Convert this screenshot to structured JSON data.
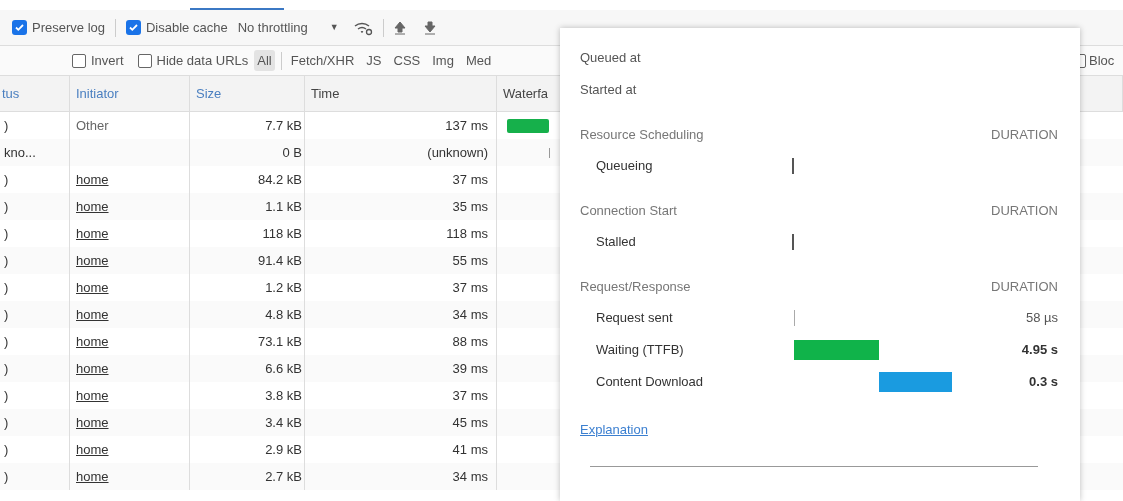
{
  "toolbar": {
    "checkboxes": [
      {
        "label": "Preserve log",
        "checked": true
      },
      {
        "label": "Disable cache",
        "checked": true
      }
    ],
    "throttling": {
      "value": "No throttling",
      "caret": "▼"
    }
  },
  "filter_bar": {
    "invert": {
      "label": "Invert",
      "checked": false
    },
    "hide_data_urls": {
      "label": "Hide data URLs",
      "checked": false
    },
    "types": [
      {
        "label": "All",
        "selected": true
      },
      {
        "label": "Fetch/XHR",
        "selected": false
      },
      {
        "label": "JS",
        "selected": false
      },
      {
        "label": "CSS",
        "selected": false
      },
      {
        "label": "Img",
        "selected": false
      },
      {
        "label": "Med",
        "selected": false
      }
    ],
    "blocked": {
      "label": "Bloc",
      "checked": false
    }
  },
  "table": {
    "columns": [
      "tus",
      "Initiator",
      "Size",
      "Time",
      "Waterfa"
    ],
    "rows": [
      {
        "status": ")",
        "initiator": "Other",
        "initiator_link": false,
        "size": "7.7 kB",
        "time": "137 ms",
        "kind": "bar"
      },
      {
        "status": "kno...",
        "size": "0 B",
        "time": "(unknown)",
        "kind": "tick"
      },
      {
        "status": ")",
        "initiator": "home",
        "initiator_link": true,
        "size": "84.2 kB",
        "time": "37 ms"
      },
      {
        "status": ")",
        "initiator": "home",
        "initiator_link": true,
        "size": "1.1 kB",
        "time": "35 ms"
      },
      {
        "status": ")",
        "initiator": "home",
        "initiator_link": true,
        "size": "118 kB",
        "time": "118 ms"
      },
      {
        "status": ")",
        "initiator": "home",
        "initiator_link": true,
        "size": "91.4 kB",
        "time": "55 ms"
      },
      {
        "status": ")",
        "initiator": "home",
        "initiator_link": true,
        "size": "1.2 kB",
        "time": "37 ms"
      },
      {
        "status": ")",
        "initiator": "home",
        "initiator_link": true,
        "size": "4.8 kB",
        "time": "34 ms"
      },
      {
        "status": ")",
        "initiator": "home",
        "initiator_link": true,
        "size": "73.1 kB",
        "time": "88 ms"
      },
      {
        "status": ")",
        "initiator": "home",
        "initiator_link": true,
        "size": "6.6 kB",
        "time": "39 ms"
      },
      {
        "status": ")",
        "initiator": "home",
        "initiator_link": true,
        "size": "3.8 kB",
        "time": "37 ms"
      },
      {
        "status": ")",
        "initiator": "home",
        "initiator_link": true,
        "size": "3.4 kB",
        "time": "45 ms"
      },
      {
        "status": ")",
        "initiator": "home",
        "initiator_link": true,
        "size": "2.9 kB",
        "time": "41 ms"
      },
      {
        "status": ")",
        "initiator": "home",
        "initiator_link": true,
        "size": "2.7 kB",
        "time": "34 ms"
      }
    ]
  },
  "timing_popup": {
    "top_lines": [
      "Queued at",
      "Started at"
    ],
    "sections": [
      {
        "title": "Resource Scheduling",
        "duration_label": "DURATION",
        "items": [
          {
            "label": "Queueing",
            "kind": "tick"
          }
        ]
      },
      {
        "title": "Connection Start",
        "duration_label": "DURATION",
        "items": [
          {
            "label": "Stalled",
            "kind": "tick"
          }
        ]
      },
      {
        "title": "Request/Response",
        "duration_label": "DURATION",
        "items": [
          {
            "label": "Request sent",
            "kind": "thin",
            "value": "58 µs"
          },
          {
            "label": "Waiting (TTFB)",
            "kind": "bar",
            "color": "#10b34a",
            "value": "4.95 s",
            "bold": true
          },
          {
            "label": "Content Download",
            "kind": "bar",
            "color": "#1a9be0",
            "value": "0.3 s",
            "bold": true
          }
        ]
      }
    ],
    "link": "Explanation"
  }
}
